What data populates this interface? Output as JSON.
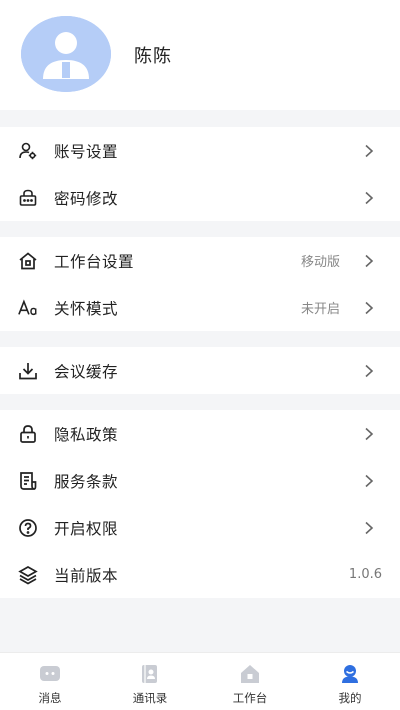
{
  "profile": {
    "name": "陈陈"
  },
  "groups": [
    {
      "items": [
        {
          "label": "账号设置",
          "icon": "user-gear-icon"
        },
        {
          "label": "密码修改",
          "icon": "lock-box-icon"
        }
      ]
    },
    {
      "items": [
        {
          "label": "工作台设置",
          "icon": "home-icon",
          "value": "移动版"
        },
        {
          "label": "关怀模式",
          "icon": "font-size-icon",
          "value": "未开启"
        }
      ]
    },
    {
      "items": [
        {
          "label": "会议缓存",
          "icon": "download-icon"
        }
      ]
    },
    {
      "items": [
        {
          "label": "隐私政策",
          "icon": "padlock-icon"
        },
        {
          "label": "服务条款",
          "icon": "document-icon"
        },
        {
          "label": "开启权限",
          "icon": "question-icon"
        },
        {
          "label": "当前版本",
          "icon": "layers-icon",
          "value": "1.0.6"
        }
      ]
    }
  ],
  "bottom_nav": [
    {
      "label": "消息",
      "icon": "message-icon"
    },
    {
      "label": "通讯录",
      "icon": "contacts-icon"
    },
    {
      "label": "工作台",
      "icon": "workbench-icon"
    },
    {
      "label": "我的",
      "icon": "profile-icon",
      "active": true
    }
  ],
  "colors": {
    "accent": "#2f6fe0",
    "avatar_bg": "#b5cdf7"
  }
}
